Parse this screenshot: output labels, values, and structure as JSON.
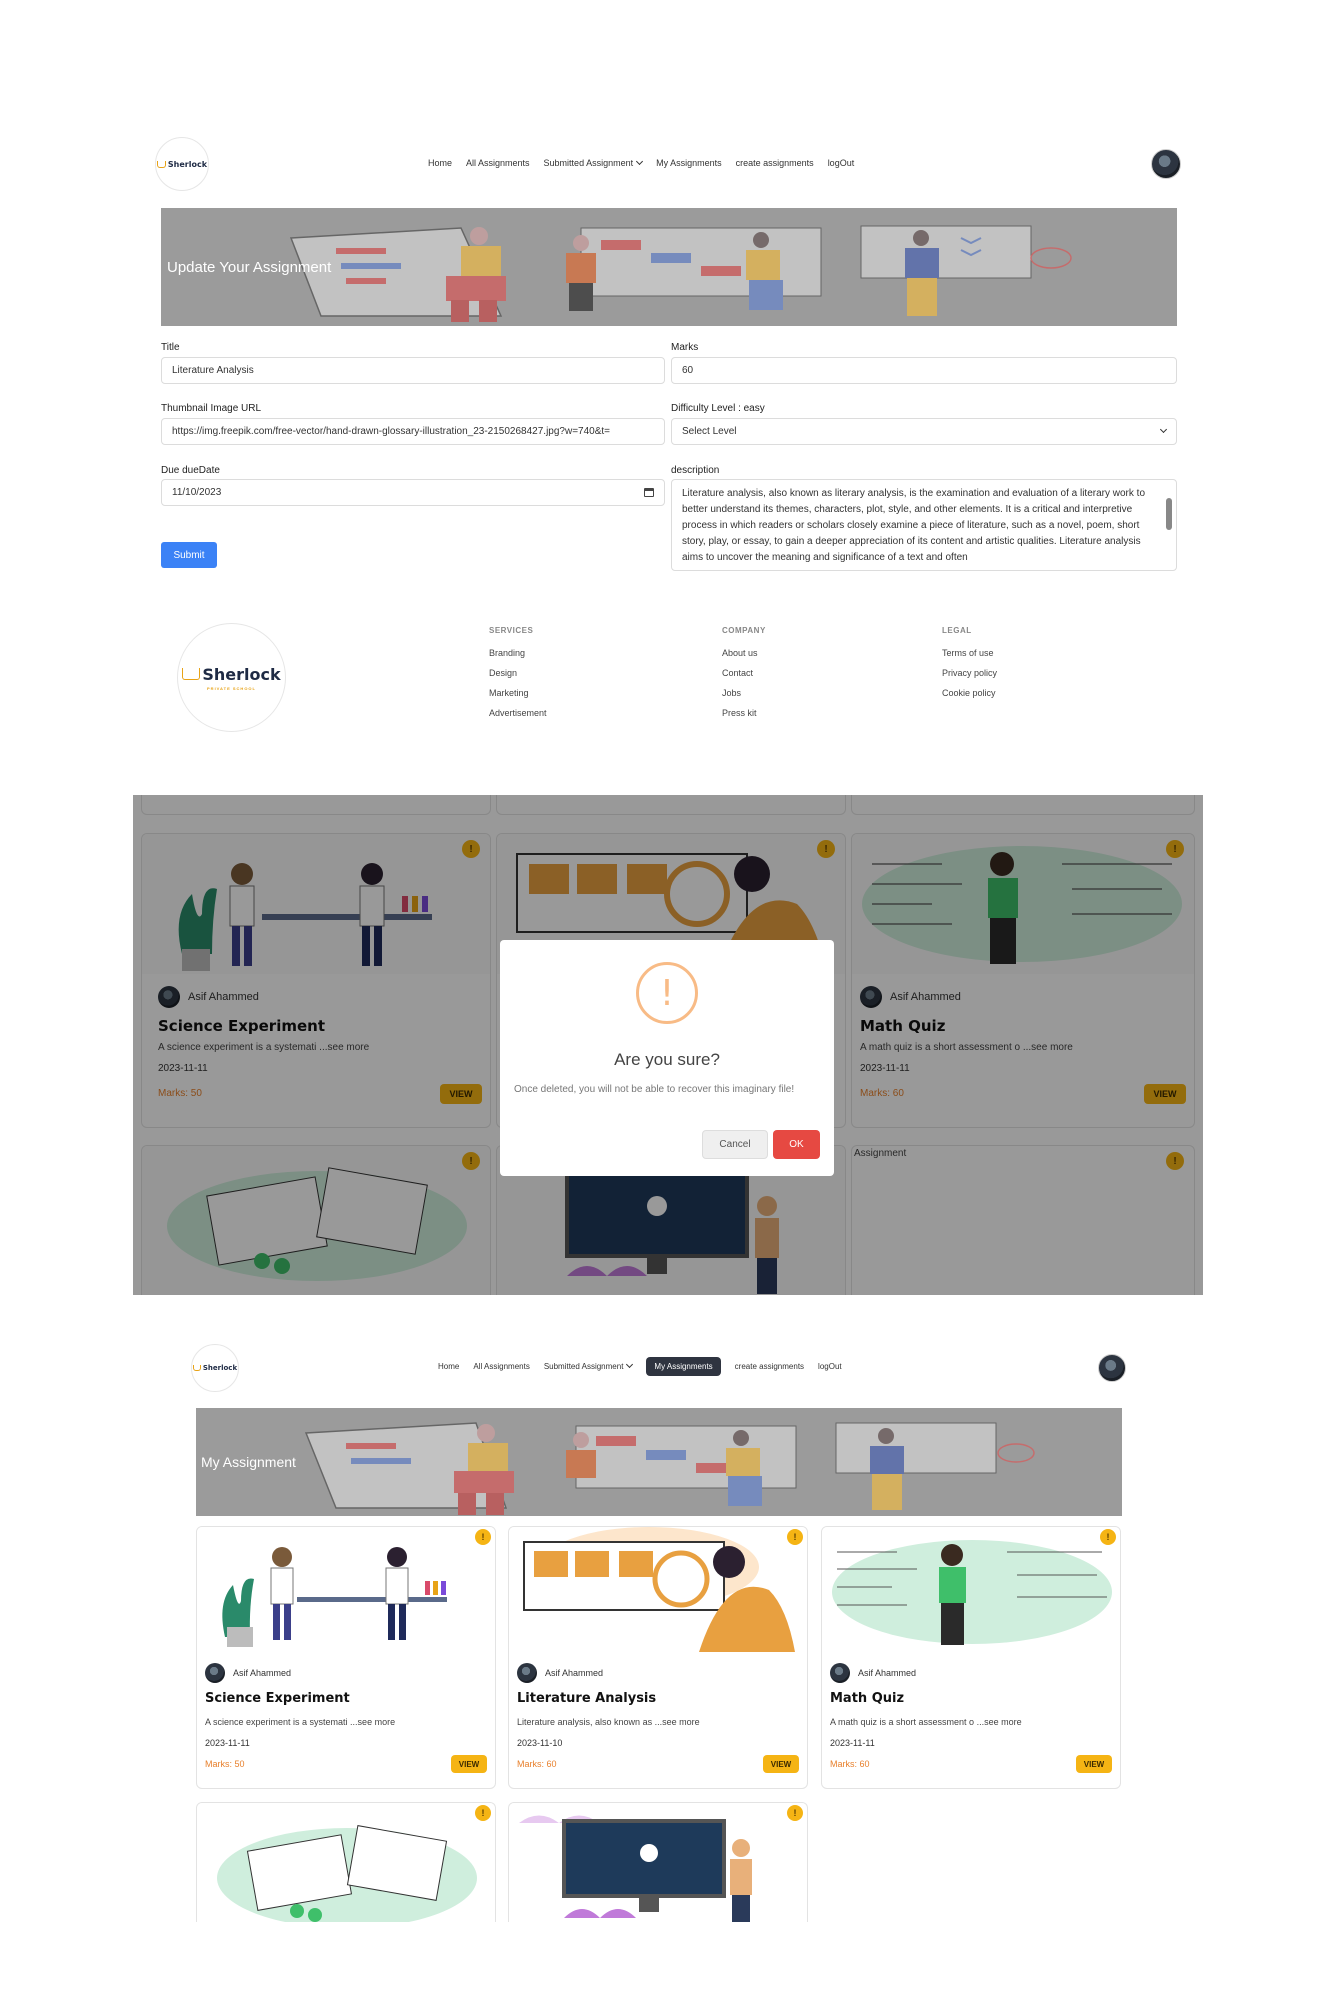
{
  "nav": {
    "logo_text": "Sherlock",
    "items": [
      "Home",
      "All Assignments",
      "Submitted Assignment",
      "My Assignments",
      "create assignments",
      "logOut"
    ]
  },
  "update_page": {
    "banner_title": "Update Your Assignment",
    "title_label": "Title",
    "title_value": "Literature Analysis",
    "marks_label": "Marks",
    "marks_value": "60",
    "thumb_label": "Thumbnail Image URL",
    "thumb_value": "https://img.freepik.com/free-vector/hand-drawn-glossary-illustration_23-2150268427.jpg?w=740&t=",
    "difficulty_label": "Difficulty Level : easy",
    "difficulty_selected": "Select Level",
    "due_label": "Due dueDate",
    "due_value": "11/10/2023",
    "description_label": "description",
    "description_value": "Literature analysis, also known as literary analysis, is the examination and evaluation of a literary work to better understand its themes, characters, plot, style, and other elements. It is a critical and interpretive process in which readers or scholars closely examine a piece of literature, such as a novel, poem, short story, play, or essay, to gain a deeper appreciation of its content and artistic qualities. Literature analysis aims to uncover the meaning and significance of a text and often",
    "submit_label": "Submit"
  },
  "footer": {
    "logo_text": "Sherlock",
    "logo_sub": "PRIVATE SCHOOL",
    "columns": [
      {
        "heading": "SERVICES",
        "links": [
          "Branding",
          "Design",
          "Marketing",
          "Advertisement"
        ]
      },
      {
        "heading": "COMPANY",
        "links": [
          "About us",
          "Contact",
          "Jobs",
          "Press kit"
        ]
      },
      {
        "heading": "LEGAL",
        "links": [
          "Terms of use",
          "Privacy policy",
          "Cookie policy"
        ]
      }
    ]
  },
  "delete_modal": {
    "title": "Are you sure?",
    "text": "Once deleted, you will not be able to recover this imaginary file!",
    "cancel_label": "Cancel",
    "ok_label": "OK",
    "broken_image_alt": "Assignment"
  },
  "my_page": {
    "banner_title": "My Assignment"
  },
  "cards": [
    {
      "author": "Asif Ahammed",
      "title": "Science Experiment",
      "desc": "A science experiment is a systemati ...see more",
      "date": "2023-11-11",
      "marks": "Marks: 50",
      "view": "VIEW",
      "badge": "!"
    },
    {
      "author": "Asif Ahammed",
      "title": "Literature Analysis",
      "desc": "Literature analysis, also known as ...see more",
      "date": "2023-11-10",
      "marks": "Marks: 60",
      "view": "VIEW",
      "badge": "!"
    },
    {
      "author": "Asif Ahammed",
      "title": "Math Quiz",
      "desc": "A math quiz is a short assessment o ...see more",
      "date": "2023-11-11",
      "marks": "Marks: 60",
      "view": "VIEW",
      "badge": "!"
    }
  ],
  "colors": {
    "accent": "#f5b414",
    "primary": "#3b82f6",
    "danger": "#e64942",
    "marks": "#e8802c",
    "nav_active": "#2f3440"
  }
}
